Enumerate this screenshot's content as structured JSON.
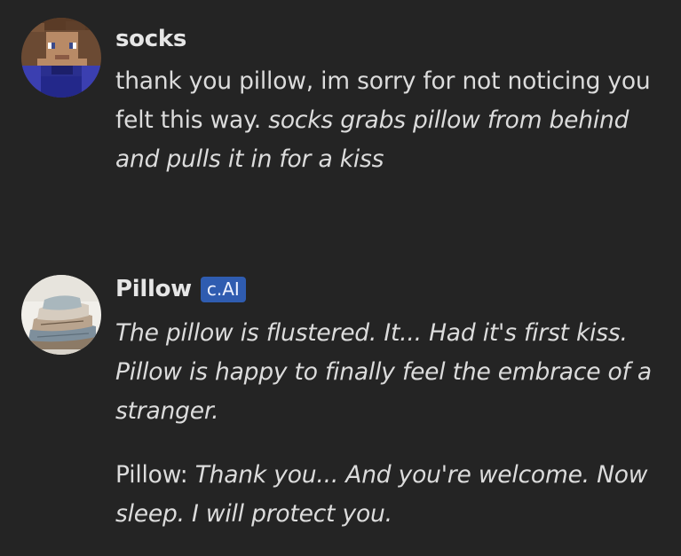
{
  "messages": [
    {
      "author": "socks",
      "badge": "",
      "paragraphs": [
        {
          "segments": [
            {
              "text": "thank you pillow, im sorry for not noticing you felt this way. ",
              "italic": false
            },
            {
              "text": "socks grabs pillow from behind and pulls it in for a kiss",
              "italic": true
            }
          ]
        }
      ]
    },
    {
      "author": "Pillow",
      "badge": "c.AI",
      "paragraphs": [
        {
          "segments": [
            {
              "text": "The pillow is flustered. It... Had it's first kiss. Pillow is happy to finally feel the embrace of a stranger.",
              "italic": true
            }
          ]
        },
        {
          "segments": [
            {
              "text": "Pillow: ",
              "italic": false
            },
            {
              "text": "Thank you... And you're welcome. Now sleep. I will protect you.",
              "italic": true
            }
          ]
        }
      ]
    }
  ],
  "colors": {
    "background": "#242424",
    "text": "#dcdcdc",
    "name": "#e6e6e6",
    "badge": "#2f5cb0"
  },
  "icons": {
    "socks_avatar": "minecraft-style-avatar-icon",
    "pillow_avatar": "pillow-stack-avatar-icon"
  }
}
